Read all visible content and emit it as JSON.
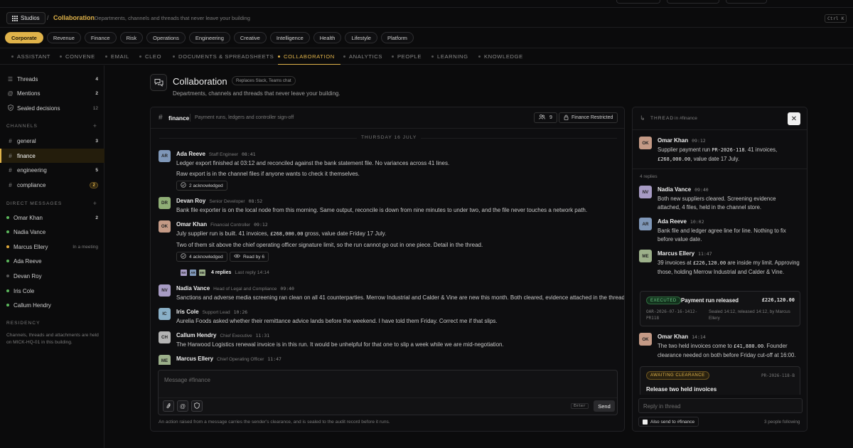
{
  "topbar": {
    "studios_label": "Studios",
    "crumb_sep": "/",
    "crumb_title": "Collaboration",
    "crumb_sub": "Departments, channels and threads that never leave your building",
    "kbd": "Ctrl K"
  },
  "chips": [
    {
      "label": "Corporate",
      "active": true
    },
    {
      "label": "Revenue"
    },
    {
      "label": "Finance"
    },
    {
      "label": "Risk"
    },
    {
      "label": "Operations"
    },
    {
      "label": "Engineering"
    },
    {
      "label": "Creative"
    },
    {
      "label": "Intelligence"
    },
    {
      "label": "Health"
    },
    {
      "label": "Lifestyle"
    },
    {
      "label": "Platform"
    }
  ],
  "nav": [
    "ASSISTANT",
    "CONVENE",
    "EMAIL",
    "CLEO",
    "DOCUMENTS & SPREADSHEETS",
    "COLLABORATION",
    "ANALYTICS",
    "PEOPLE",
    "LEARNING",
    "KNOWLEDGE"
  ],
  "nav_active": "COLLABORATION",
  "sidebar": {
    "top": [
      {
        "icon": "threads-icon",
        "label": "Threads",
        "count": "4"
      },
      {
        "icon": "at-icon",
        "label": "Mentions",
        "count": "2"
      },
      {
        "icon": "shield-icon",
        "label": "Sealed decisions",
        "count": "12"
      }
    ],
    "channels_head": "CHANNELS",
    "channels": [
      {
        "label": "general",
        "count": "3"
      },
      {
        "label": "finance",
        "count": "",
        "active": true
      },
      {
        "label": "engineering",
        "count": "5"
      },
      {
        "label": "compliance",
        "count": "2",
        "pill": true
      }
    ],
    "dm_head": "DIRECT MESSAGES",
    "dms": [
      {
        "label": "Omar Khan",
        "count": "2",
        "status": "online"
      },
      {
        "label": "Nadia Vance",
        "count": "",
        "status": "online"
      },
      {
        "label": "Marcus Ellery",
        "count": "",
        "status": "busy",
        "note": "In a meeting"
      },
      {
        "label": "Ada Reeve",
        "count": "",
        "status": "online"
      },
      {
        "label": "Devan Roy",
        "count": "",
        "status": "away"
      },
      {
        "label": "Iris Cole",
        "count": "",
        "status": "online"
      },
      {
        "label": "Callum Hendry",
        "count": "",
        "status": "online"
      }
    ],
    "residency_head": "RESIDENCY",
    "residency_text": "Channels, threads and attachments are held on MICK-HQ-01 in this building."
  },
  "page": {
    "title": "Collaboration",
    "badge": "Replaces Slack, Teams chat",
    "subtitle": "Departments, channels and threads that never leave your building."
  },
  "channel": {
    "name": "finance",
    "desc": "Payment runs, ledgers and controller sign-off",
    "members": "9",
    "restricted": "Finance Restricted",
    "day": "THURSDAY 16 JULY",
    "messages": [
      {
        "initials": "AR",
        "color": "#7f97b8",
        "name": "Ada Reeve",
        "role": "Staff Engineer",
        "time": "08:41",
        "lines": [
          "Ledger export finished at 03:12 and reconciled against the bank statement file. No variances across 41 lines.",
          "Raw export is in the channel files if anyone wants to check it themselves."
        ],
        "ack": "2 acknowledged"
      },
      {
        "initials": "DR",
        "color": "#8fae76",
        "name": "Devan Roy",
        "role": "Senior Developer",
        "time": "08:52",
        "lines": [
          "Bank file exporter is on the local node from this morning. Same output, reconcile is down from nine minutes to under two, and the file never touches a network path."
        ]
      },
      {
        "initials": "OK",
        "color": "#c49a86",
        "name": "Omar Khan",
        "role": "Financial Controller",
        "time": "09:12",
        "line1_a": "July supplier run is built. 41 invoices, ",
        "line1_amount": "£268,000.00",
        "line1_b": " gross, value date Friday 17 July.",
        "lines": [
          "Two of them sit above the chief operating officer signature limit, so the run cannot go out in one piece. Detail in the thread."
        ],
        "ack": "4 acknowledged",
        "read": "Read by 6",
        "replies": {
          "avatars": [
            "NV",
            "AR",
            "ME"
          ],
          "count": "4 replies",
          "last": "Last reply 14:14"
        }
      },
      {
        "initials": "NV",
        "color": "#a79bc4",
        "name": "Nadia Vance",
        "role": "Head of Legal and Compliance",
        "time": "09:40",
        "lines": [
          "Sanctions and adverse media screening ran clean on all 41 counterparties. Merrow Industrial and Calder & Vine are new this month. Both cleared, evidence attached in the thread."
        ]
      },
      {
        "initials": "IC",
        "color": "#8ab0c8",
        "name": "Iris Cole",
        "role": "Support Lead",
        "time": "10:26",
        "lines": [
          "Aurelia Foods asked whether their remittance advice lands before the weekend. I have told them Friday. Correct me if that slips."
        ]
      },
      {
        "initials": "CH",
        "color": "#b4b4b4",
        "name": "Callum Hendry",
        "role": "Chief Executive",
        "time": "11:31",
        "lines": [
          "The Harwood Logistics renewal invoice is in this run. It would be unhelpful for that one to slip a week while we are mid-negotiation."
        ]
      },
      {
        "initials": "ME",
        "color": "#9cb08a",
        "name": "Marcus Ellery",
        "role": "Chief Operating Officer",
        "time": "11:47",
        "lines": []
      }
    ],
    "composer_placeholder": "Message #finance",
    "enter_hint": "Enter",
    "send_label": "Send",
    "footer": "An action raised from a message carries the sender's clearance, and is sealed to the audit record before it runs."
  },
  "thread": {
    "label": "THREAD",
    "in": "in #finance",
    "root": {
      "initials": "OK",
      "color": "#c49a86",
      "name": "Omar Khan",
      "time": "09:12",
      "t1": "Supplier payment run ",
      "ref": "PR-2026-118",
      "t2": ". 41 invoices, ",
      "amount": "£268,000.00",
      "t3": ", value date 17 July."
    },
    "replies_label": "4 replies",
    "replies": [
      {
        "initials": "NV",
        "color": "#a79bc4",
        "name": "Nadia Vance",
        "time": "09:40",
        "text": "Both new suppliers cleared. Screening evidence attached, 4 files, held in the channel store."
      },
      {
        "initials": "AR",
        "color": "#7f97b8",
        "name": "Ada Reeve",
        "time": "10:02",
        "text": "Bank file and ledger agree line for line. Nothing to fix before value date."
      },
      {
        "initials": "ME",
        "color": "#9cb08a",
        "name": "Marcus Ellery",
        "time": "11:47",
        "t1": "39 invoices at ",
        "amount": "£226,120.00",
        "t2": " are inside my limit. Approving those, holding Merrow Industrial and Calder & Vine."
      }
    ],
    "executed_card": {
      "badge": "EXECUTED",
      "title": "Payment run released",
      "amount": "£226,120.00",
      "ref": "OAR-2026-07-16-1412-PR118",
      "note": "Sealed 14:12, released 14:12, by Marcus Ellery"
    },
    "omar_reply": {
      "initials": "OK",
      "color": "#c49a86",
      "name": "Omar Khan",
      "time": "14:14",
      "t1": "The two held invoices come to ",
      "amount": "£41,880.00",
      "t2": ". Founder clearance needed on both before Friday cut-off at 16:00."
    },
    "awaiting_card": {
      "badge": "AWAITING CLEARANCE",
      "ref": "PR-2026-118-B",
      "title": "Release two held invoices"
    },
    "reply_placeholder": "Reply in thread",
    "also_send": "Also send to #finance",
    "following": "3 people following"
  },
  "colors": {
    "accent": "#e0b34a",
    "background": "#0b0b0c",
    "executed": "#6fd08a",
    "send_button": "#2a2a2d"
  }
}
